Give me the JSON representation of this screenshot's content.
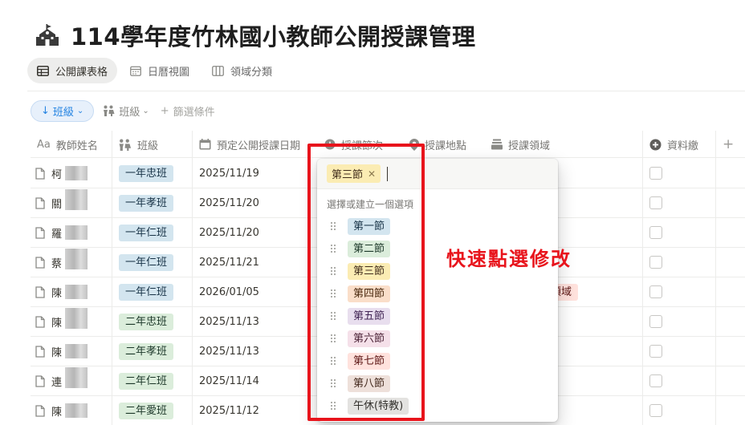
{
  "page": {
    "title": "114學年度竹林國小教師公開授課管理",
    "title_icon": "school-icon"
  },
  "views": [
    {
      "label": "公開課表格",
      "icon": "table-icon",
      "active": true
    },
    {
      "label": "日曆視圖",
      "icon": "calendar-icon",
      "active": false
    },
    {
      "label": "領域分類",
      "icon": "board-icon",
      "active": false
    }
  ],
  "filters": {
    "sort_label": "班級",
    "filter_label": "班級",
    "add_filter_label": "篩選條件"
  },
  "columns": [
    {
      "label": "教師姓名",
      "icon": "text-icon"
    },
    {
      "label": "班級",
      "icon": "people-icon"
    },
    {
      "label": "預定公開授課日期",
      "icon": "calendar-icon"
    },
    {
      "label": "授課節次",
      "icon": "clock-icon"
    },
    {
      "label": "授課地點",
      "icon": "location-icon"
    },
    {
      "label": "授課領域",
      "icon": "stack-icon"
    },
    {
      "label": "資料繳",
      "icon": "plus-circle-icon"
    }
  ],
  "add_column_label": "+",
  "rows": [
    {
      "name": "柯",
      "class": "一年忠班",
      "date": "2025/11/19"
    },
    {
      "name": "關",
      "class": "一年孝班",
      "date": "2025/11/20"
    },
    {
      "name": "羅",
      "class": "一年仁班",
      "date": "2025/11/20"
    },
    {
      "name": "蔡",
      "class": "一年仁班",
      "date": "2025/11/21"
    },
    {
      "name": "陳",
      "class": "一年仁班",
      "date": "2026/01/05",
      "domain_partial": "領域"
    },
    {
      "name": "陳",
      "class": "二年忠班",
      "date": "2025/11/13"
    },
    {
      "name": "陳",
      "class": "二年孝班",
      "date": "2025/11/13"
    },
    {
      "name": "連",
      "class": "二年仁班",
      "date": "2025/11/14"
    },
    {
      "name": "陳",
      "class": "二年愛班",
      "date": "2025/11/12"
    }
  ],
  "dropdown": {
    "selected": "第三節",
    "hint": "選擇或建立一個選項",
    "options": [
      {
        "label": "第一節",
        "bg": "#d3e5ef",
        "fg": "#183347"
      },
      {
        "label": "第二節",
        "bg": "#dbeddb",
        "fg": "#1c3829"
      },
      {
        "label": "第三節",
        "bg": "#fbecb3",
        "fg": "#402c1b"
      },
      {
        "label": "第四節",
        "bg": "#fadec9",
        "fg": "#49290e"
      },
      {
        "label": "第五節",
        "bg": "#e8deee",
        "fg": "#412454"
      },
      {
        "label": "第六節",
        "bg": "#f5e0e9",
        "fg": "#4c2337"
      },
      {
        "label": "第七節",
        "bg": "#ffe2dd",
        "fg": "#5d1715"
      },
      {
        "label": "第八節",
        "bg": "#eee0da",
        "fg": "#442a1e"
      },
      {
        "label": "午休(特教)",
        "bg": "#e3e2e0",
        "fg": "#32302c"
      }
    ]
  },
  "annotation": "快速點選修改",
  "colors": {
    "annotation": "#e8141c",
    "accent": "#2383e2"
  }
}
